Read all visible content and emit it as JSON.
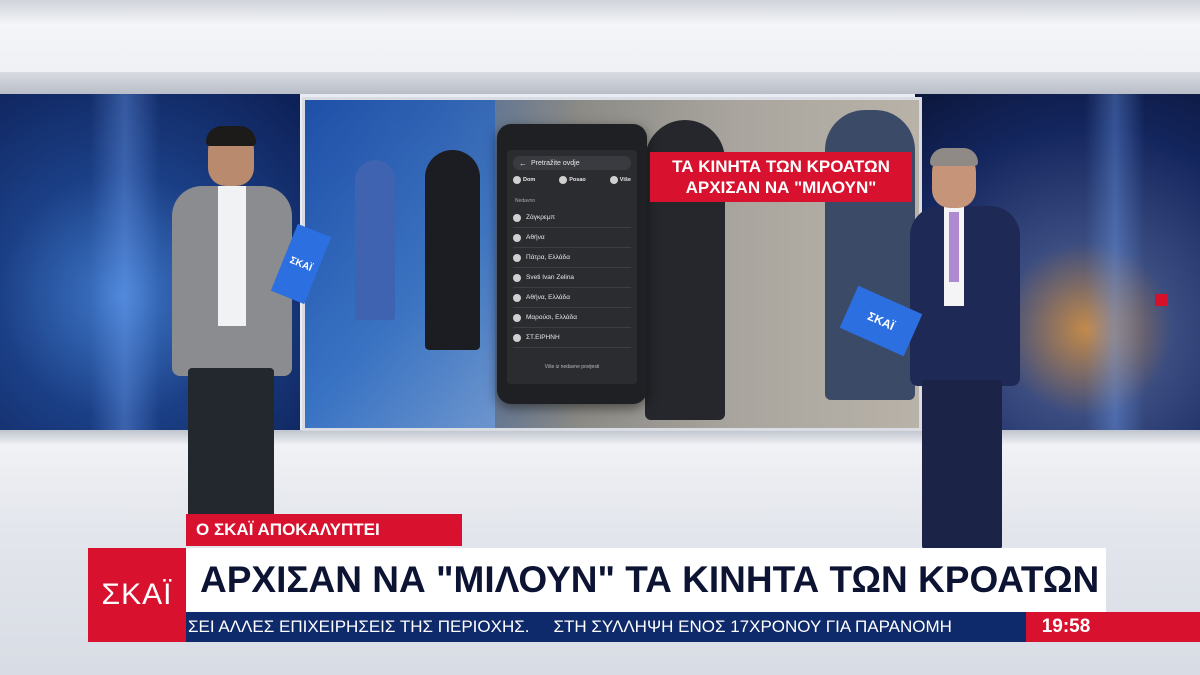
{
  "screen": {
    "caption": "ΤΑ ΚΙΝΗΤΑ ΤΩΝ ΚΡΟΑΤΩΝ ΑΡΧΙΣΑΝ ΝΑ \"ΜΙΛΟΥΝ\"",
    "phone": {
      "search_placeholder": "Pretražite ovdje",
      "chips": [
        "Dom",
        "Posao",
        "Više"
      ],
      "section_label": "Nedavno",
      "items": [
        "Ζάγκρεμπ",
        "Αθήνα",
        "Πάτρα, Ελλάδα",
        "Sveti Ivan Zelina",
        "Αθήνα, Ελλάδα",
        "Μαρούσι, Ελλάδα",
        "ΣΤ.ΕΙΡΗΝΗ"
      ],
      "more_label": "Više iz nedavne povijesti"
    }
  },
  "tablets": {
    "left_label": "ΣΚΑΪ",
    "right_label": "ΣΚΑΪ"
  },
  "lower_third": {
    "kicker": "Ο ΣΚΑΪ ΑΠΟΚΑΛΥΠΤΕΙ",
    "logo": "ΣΚΑΪ",
    "headline": "ΑΡΧΙΣΑΝ ΝΑ \"ΜΙΛΟΥΝ\" ΤΑ ΚΙΝΗΤΑ ΤΩΝ ΚΡΟΑΤΩΝ",
    "ticker": [
      "ΣΕΙ ΑΛΛΕΣ ΕΠΙΧΕΙΡΗΣΕΙΣ ΤΗΣ ΠΕΡΙΟΧΗΣ.",
      "ΣΤΗ ΣΥΛΛΗΨΗ ΕΝΟΣ 17ΧΡΟΝΟΥ ΓΙΑ ΠΑΡΑΝΟΜΗ"
    ],
    "time": "19:58"
  },
  "colors": {
    "brand_red": "#d8122e",
    "ticker_blue": "#0f2a6a",
    "headline_text": "#0d1433"
  }
}
